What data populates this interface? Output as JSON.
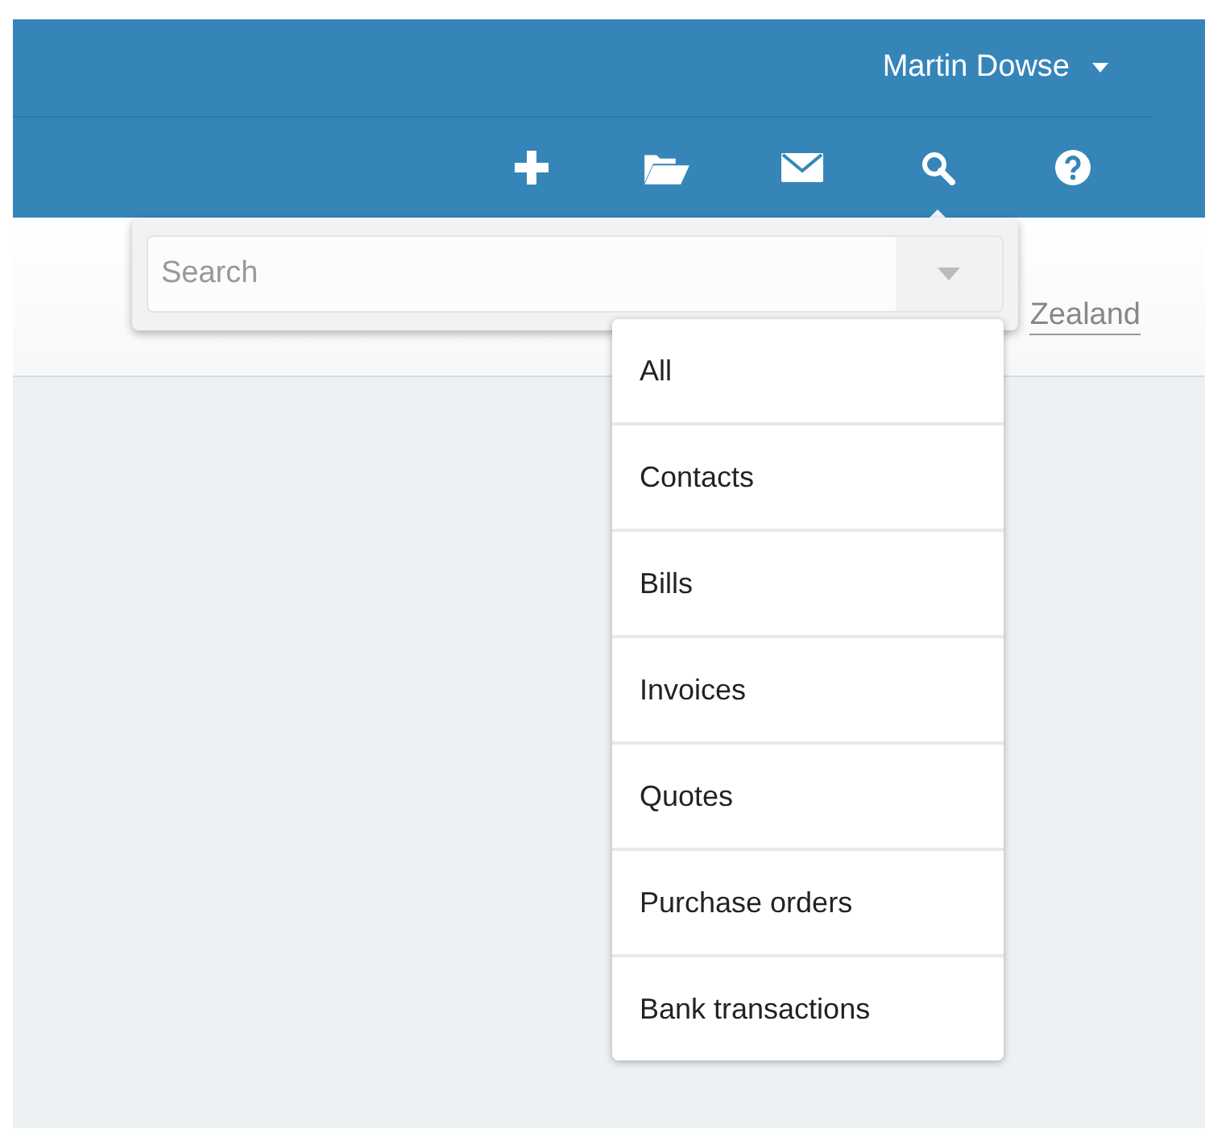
{
  "header": {
    "user_name": "Martin Dowse"
  },
  "toolbar": [
    {
      "kind": "add"
    },
    {
      "kind": "folder"
    },
    {
      "kind": "mail"
    },
    {
      "kind": "search",
      "selected": true
    },
    {
      "kind": "help"
    }
  ],
  "page": {
    "link_text": "Zealand"
  },
  "search": {
    "placeholder": "Search"
  },
  "search_scope_menu": {
    "items": [
      {
        "label": "All"
      },
      {
        "label": "Contacts"
      },
      {
        "label": "Bills"
      },
      {
        "label": "Invoices"
      },
      {
        "label": "Quotes"
      },
      {
        "label": "Purchase orders"
      },
      {
        "label": "Bank transactions"
      }
    ]
  }
}
